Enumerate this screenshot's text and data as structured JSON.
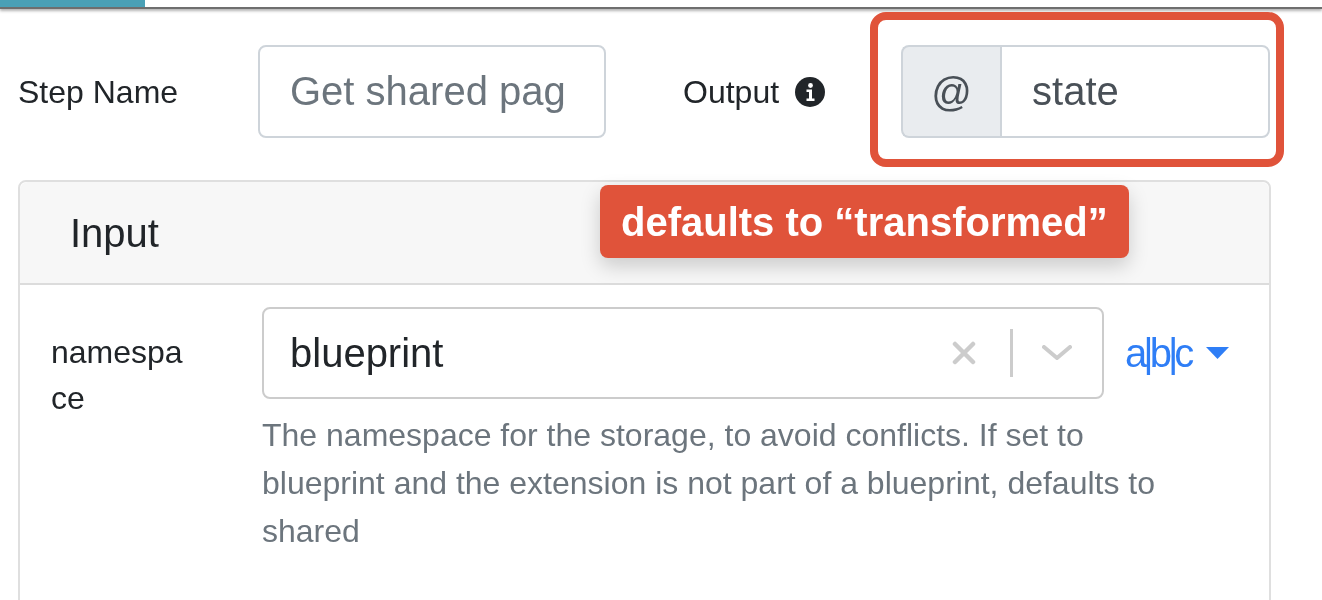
{
  "step_name": {
    "label": "Step Name",
    "placeholder": "Get shared pag"
  },
  "output": {
    "label": "Output",
    "prefix": "@",
    "value": "state",
    "highlighted": true
  },
  "callout": {
    "text": "defaults to “transformed”"
  },
  "input_card": {
    "title": "Input",
    "fields": [
      {
        "label": "namespace",
        "value": "blueprint",
        "type_toggle": "a|b|c",
        "help": "The namespace for the storage, to avoid conflicts. If set to blueprint and the extension is not part of a blueprint, defaults to shared"
      }
    ]
  }
}
